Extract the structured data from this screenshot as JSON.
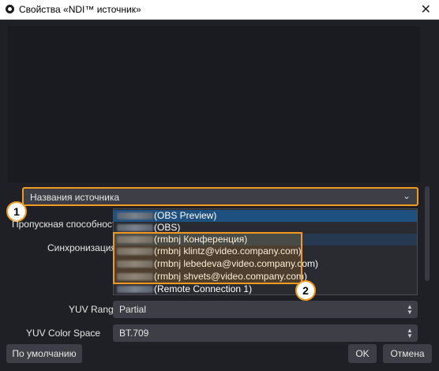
{
  "window": {
    "title": "Свойства «NDI™ источник»",
    "close_glyph": "✕"
  },
  "source": {
    "label": "Названия источника",
    "chevron": "⌄"
  },
  "badges": [
    "1",
    "2"
  ],
  "form": {
    "bandwidth_label": "Пропускная способность",
    "sync_label": "Синхронизация",
    "yuv_range_label": "YUV Range",
    "yuv_range_value": "Partial",
    "yuv_color_space_label": "YUV Color Space",
    "yuv_color_space_value": "BT.709"
  },
  "dropdown": {
    "items": [
      "(OBS Preview)",
      "(OBS)",
      "(rmbnj Конференция)",
      "(rmbnj klintz@video.company.com)",
      "(rmbnj lebedeva@video.company.com)",
      "(rmbnj shvets@video.company.com)",
      "(Remote Connection 1)"
    ],
    "selected_index": 0,
    "hover_index": 2
  },
  "buttons": {
    "defaults": "По умолчанию",
    "ok": "OK",
    "cancel": "Отмена"
  },
  "colors": {
    "accent_orange": "#f09a20",
    "selection_blue": "#1e5080",
    "background": "#1f1f26"
  }
}
